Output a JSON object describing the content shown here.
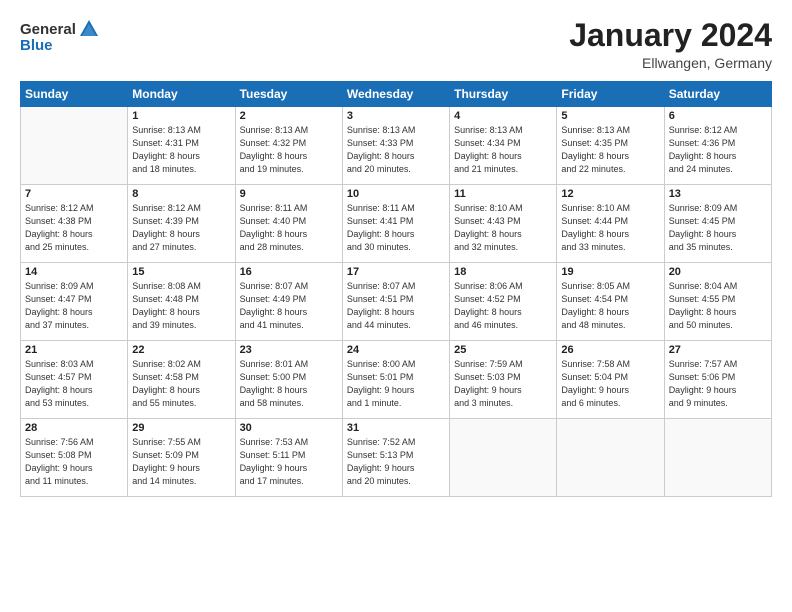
{
  "header": {
    "logo_general": "General",
    "logo_blue": "Blue",
    "month": "January 2024",
    "location": "Ellwangen, Germany"
  },
  "weekdays": [
    "Sunday",
    "Monday",
    "Tuesday",
    "Wednesday",
    "Thursday",
    "Friday",
    "Saturday"
  ],
  "weeks": [
    [
      {
        "day": "",
        "info": ""
      },
      {
        "day": "1",
        "info": "Sunrise: 8:13 AM\nSunset: 4:31 PM\nDaylight: 8 hours\nand 18 minutes."
      },
      {
        "day": "2",
        "info": "Sunrise: 8:13 AM\nSunset: 4:32 PM\nDaylight: 8 hours\nand 19 minutes."
      },
      {
        "day": "3",
        "info": "Sunrise: 8:13 AM\nSunset: 4:33 PM\nDaylight: 8 hours\nand 20 minutes."
      },
      {
        "day": "4",
        "info": "Sunrise: 8:13 AM\nSunset: 4:34 PM\nDaylight: 8 hours\nand 21 minutes."
      },
      {
        "day": "5",
        "info": "Sunrise: 8:13 AM\nSunset: 4:35 PM\nDaylight: 8 hours\nand 22 minutes."
      },
      {
        "day": "6",
        "info": "Sunrise: 8:12 AM\nSunset: 4:36 PM\nDaylight: 8 hours\nand 24 minutes."
      }
    ],
    [
      {
        "day": "7",
        "info": "Sunrise: 8:12 AM\nSunset: 4:38 PM\nDaylight: 8 hours\nand 25 minutes."
      },
      {
        "day": "8",
        "info": "Sunrise: 8:12 AM\nSunset: 4:39 PM\nDaylight: 8 hours\nand 27 minutes."
      },
      {
        "day": "9",
        "info": "Sunrise: 8:11 AM\nSunset: 4:40 PM\nDaylight: 8 hours\nand 28 minutes."
      },
      {
        "day": "10",
        "info": "Sunrise: 8:11 AM\nSunset: 4:41 PM\nDaylight: 8 hours\nand 30 minutes."
      },
      {
        "day": "11",
        "info": "Sunrise: 8:10 AM\nSunset: 4:43 PM\nDaylight: 8 hours\nand 32 minutes."
      },
      {
        "day": "12",
        "info": "Sunrise: 8:10 AM\nSunset: 4:44 PM\nDaylight: 8 hours\nand 33 minutes."
      },
      {
        "day": "13",
        "info": "Sunrise: 8:09 AM\nSunset: 4:45 PM\nDaylight: 8 hours\nand 35 minutes."
      }
    ],
    [
      {
        "day": "14",
        "info": "Sunrise: 8:09 AM\nSunset: 4:47 PM\nDaylight: 8 hours\nand 37 minutes."
      },
      {
        "day": "15",
        "info": "Sunrise: 8:08 AM\nSunset: 4:48 PM\nDaylight: 8 hours\nand 39 minutes."
      },
      {
        "day": "16",
        "info": "Sunrise: 8:07 AM\nSunset: 4:49 PM\nDaylight: 8 hours\nand 41 minutes."
      },
      {
        "day": "17",
        "info": "Sunrise: 8:07 AM\nSunset: 4:51 PM\nDaylight: 8 hours\nand 44 minutes."
      },
      {
        "day": "18",
        "info": "Sunrise: 8:06 AM\nSunset: 4:52 PM\nDaylight: 8 hours\nand 46 minutes."
      },
      {
        "day": "19",
        "info": "Sunrise: 8:05 AM\nSunset: 4:54 PM\nDaylight: 8 hours\nand 48 minutes."
      },
      {
        "day": "20",
        "info": "Sunrise: 8:04 AM\nSunset: 4:55 PM\nDaylight: 8 hours\nand 50 minutes."
      }
    ],
    [
      {
        "day": "21",
        "info": "Sunrise: 8:03 AM\nSunset: 4:57 PM\nDaylight: 8 hours\nand 53 minutes."
      },
      {
        "day": "22",
        "info": "Sunrise: 8:02 AM\nSunset: 4:58 PM\nDaylight: 8 hours\nand 55 minutes."
      },
      {
        "day": "23",
        "info": "Sunrise: 8:01 AM\nSunset: 5:00 PM\nDaylight: 8 hours\nand 58 minutes."
      },
      {
        "day": "24",
        "info": "Sunrise: 8:00 AM\nSunset: 5:01 PM\nDaylight: 9 hours\nand 1 minute."
      },
      {
        "day": "25",
        "info": "Sunrise: 7:59 AM\nSunset: 5:03 PM\nDaylight: 9 hours\nand 3 minutes."
      },
      {
        "day": "26",
        "info": "Sunrise: 7:58 AM\nSunset: 5:04 PM\nDaylight: 9 hours\nand 6 minutes."
      },
      {
        "day": "27",
        "info": "Sunrise: 7:57 AM\nSunset: 5:06 PM\nDaylight: 9 hours\nand 9 minutes."
      }
    ],
    [
      {
        "day": "28",
        "info": "Sunrise: 7:56 AM\nSunset: 5:08 PM\nDaylight: 9 hours\nand 11 minutes."
      },
      {
        "day": "29",
        "info": "Sunrise: 7:55 AM\nSunset: 5:09 PM\nDaylight: 9 hours\nand 14 minutes."
      },
      {
        "day": "30",
        "info": "Sunrise: 7:53 AM\nSunset: 5:11 PM\nDaylight: 9 hours\nand 17 minutes."
      },
      {
        "day": "31",
        "info": "Sunrise: 7:52 AM\nSunset: 5:13 PM\nDaylight: 9 hours\nand 20 minutes."
      },
      {
        "day": "",
        "info": ""
      },
      {
        "day": "",
        "info": ""
      },
      {
        "day": "",
        "info": ""
      }
    ]
  ]
}
